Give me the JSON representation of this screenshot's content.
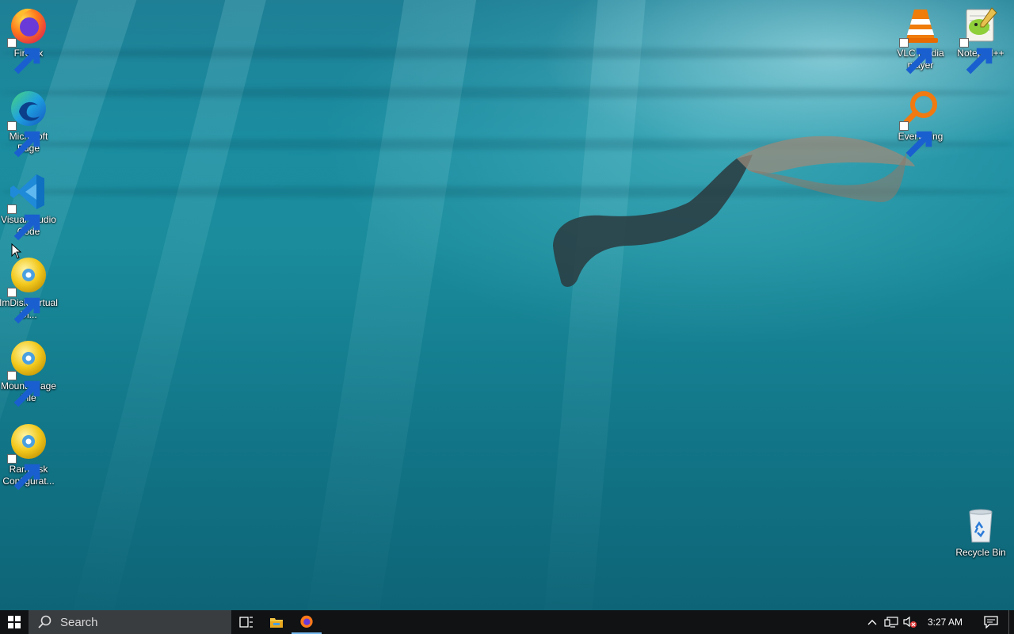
{
  "desktop": {
    "icons_left": [
      {
        "label": "Firefox",
        "icon": "firefox-icon"
      },
      {
        "label": "Microsoft Edge",
        "icon": "edge-icon"
      },
      {
        "label": "Visual Studio Code",
        "icon": "vscode-icon"
      },
      {
        "label": "ImDisk Virtual Di...",
        "icon": "imdisk-icon"
      },
      {
        "label": "Mount Image File",
        "icon": "disc-icon"
      },
      {
        "label": "RamDisk Configurat...",
        "icon": "disc-icon"
      }
    ],
    "icons_right": [
      {
        "label": "VLC media player",
        "icon": "vlc-icon"
      },
      {
        "label": "Notepad++",
        "icon": "notepadpp-icon"
      },
      {
        "label": "Everything",
        "icon": "everything-icon"
      },
      {
        "label": "Recycle Bin",
        "icon": "recycle-bin-icon"
      }
    ]
  },
  "taskbar": {
    "search_placeholder": "Search",
    "clock": "3:27 AM",
    "pinned": [
      "task-view",
      "file-explorer",
      "firefox"
    ],
    "tray": [
      "chevron-up",
      "network",
      "volume-muted"
    ]
  },
  "colors": {
    "taskbar_bg": "#101214",
    "search_bg": "#3a3d40",
    "water": "#1a8c9c"
  }
}
